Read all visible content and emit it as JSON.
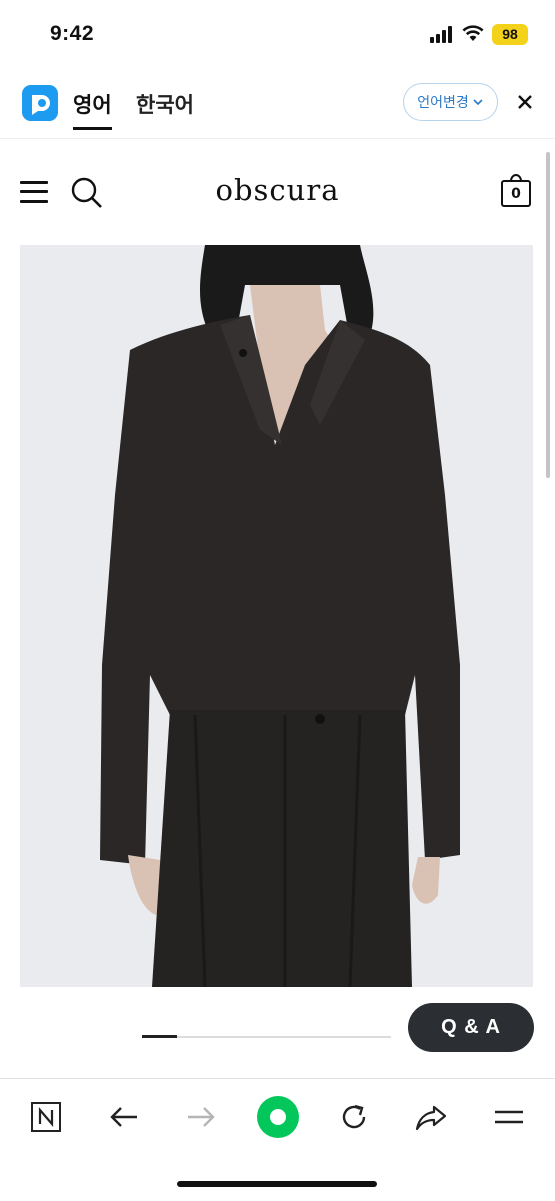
{
  "status": {
    "time": "9:42",
    "battery": "98"
  },
  "translation": {
    "tab_english": "영어",
    "tab_korean": "한국어",
    "change_language": "언어변경",
    "close_icon": "close-icon"
  },
  "site": {
    "brand": "obscura",
    "cart_count": "0",
    "menu_icon": "hamburger-menu-icon",
    "search_icon": "search-icon",
    "cart_icon": "shopping-bag-icon"
  },
  "product": {
    "image_alt": "model wearing black oversized shirt and pleated trousers",
    "gallery_progress": 0.14
  },
  "qa_button": "Q & A",
  "toolbar": {
    "icons": [
      "naver-n-icon",
      "back-arrow-icon",
      "forward-arrow-icon",
      "green-dot-icon",
      "refresh-icon",
      "share-icon",
      "menu-icon"
    ]
  },
  "colors": {
    "papago_blue": "#1d9bf0",
    "battery_yellow": "#f4d21a",
    "naver_green": "#03c75a",
    "qa_dark": "#2b2e33"
  }
}
